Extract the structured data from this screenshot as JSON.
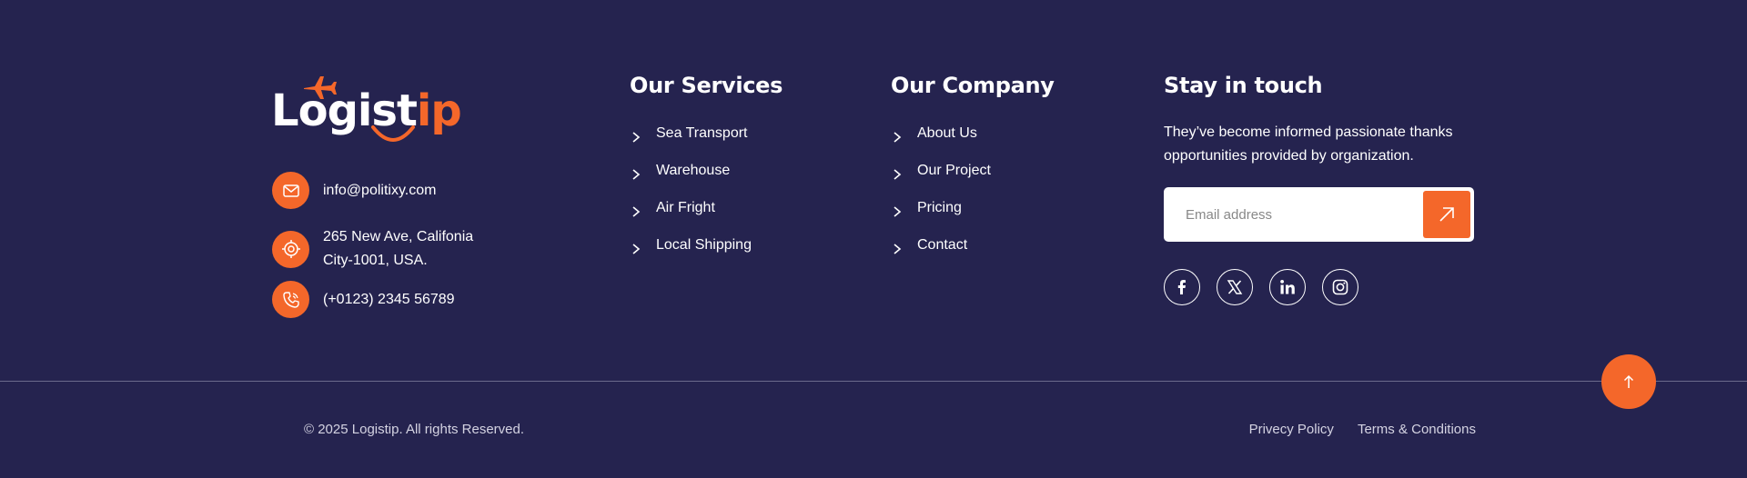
{
  "brand": {
    "logo_text_main": "Logist",
    "logo_text_accent": "ip",
    "accent_color": "#f4672a",
    "background_color": "#25234f"
  },
  "contact": {
    "email": "info@politixy.com",
    "address_line1": "265 New Ave, Califonia",
    "address_line2": "City-1001, USA.",
    "phone": "(+0123) 2345 56789",
    "icons": [
      "envelope-icon",
      "location-target-icon",
      "phone-icon"
    ]
  },
  "services": {
    "heading": "Our Services",
    "items": [
      {
        "label": "Sea Transport"
      },
      {
        "label": "Warehouse"
      },
      {
        "label": "Air Fright"
      },
      {
        "label": "Local Shipping"
      }
    ]
  },
  "company": {
    "heading": "Our Company",
    "items": [
      {
        "label": "About Us"
      },
      {
        "label": "Our Project"
      },
      {
        "label": "Pricing"
      },
      {
        "label": "Contact"
      }
    ]
  },
  "touch": {
    "heading": "Stay in touch",
    "description_line1": "They’ve become  informed passionate thanks",
    "description_line2": "opportunities provided by organization.",
    "email_placeholder": "Email address",
    "submit_icon": "arrow-up-right-icon",
    "socials": [
      "facebook-icon",
      "x-twitter-icon",
      "linkedin-icon",
      "instagram-icon"
    ]
  },
  "bottom": {
    "copyright": "© 2025 Logistip. All rights Reserved.",
    "privacy": "Privecy Policy",
    "terms": "Terms & Conditions",
    "scroll_top_icon": "arrow-up-icon"
  }
}
